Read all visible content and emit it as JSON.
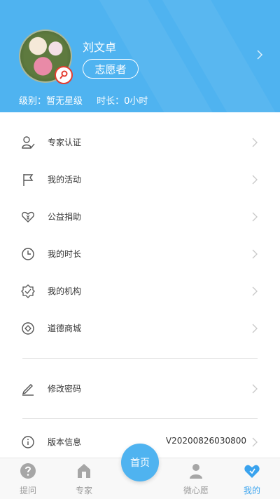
{
  "profile": {
    "name": "刘文卓",
    "role": "志愿者",
    "level_text": "级别：暂无星级",
    "hours_text": "时长：0小时"
  },
  "menu": {
    "items": [
      {
        "label": "专家认证",
        "icon": "expert-verify-icon"
      },
      {
        "label": "我的活动",
        "icon": "flag-icon"
      },
      {
        "label": "公益捐助",
        "icon": "donation-heart-icon"
      },
      {
        "label": "我的时长",
        "icon": "clock-icon"
      },
      {
        "label": "我的机构",
        "icon": "organization-icon"
      },
      {
        "label": "道德商城",
        "icon": "mall-icon"
      }
    ],
    "change_password": "修改密码",
    "version_label": "版本信息",
    "version_value": "V20200826030800"
  },
  "bottom_nav": {
    "ask": "提问",
    "expert": "专家",
    "home": "首页",
    "wish": "微心愿",
    "mine": "我的"
  },
  "colors": {
    "primary": "#4fb3f0",
    "active": "#3aa3ee",
    "badge": "#e43d30"
  }
}
